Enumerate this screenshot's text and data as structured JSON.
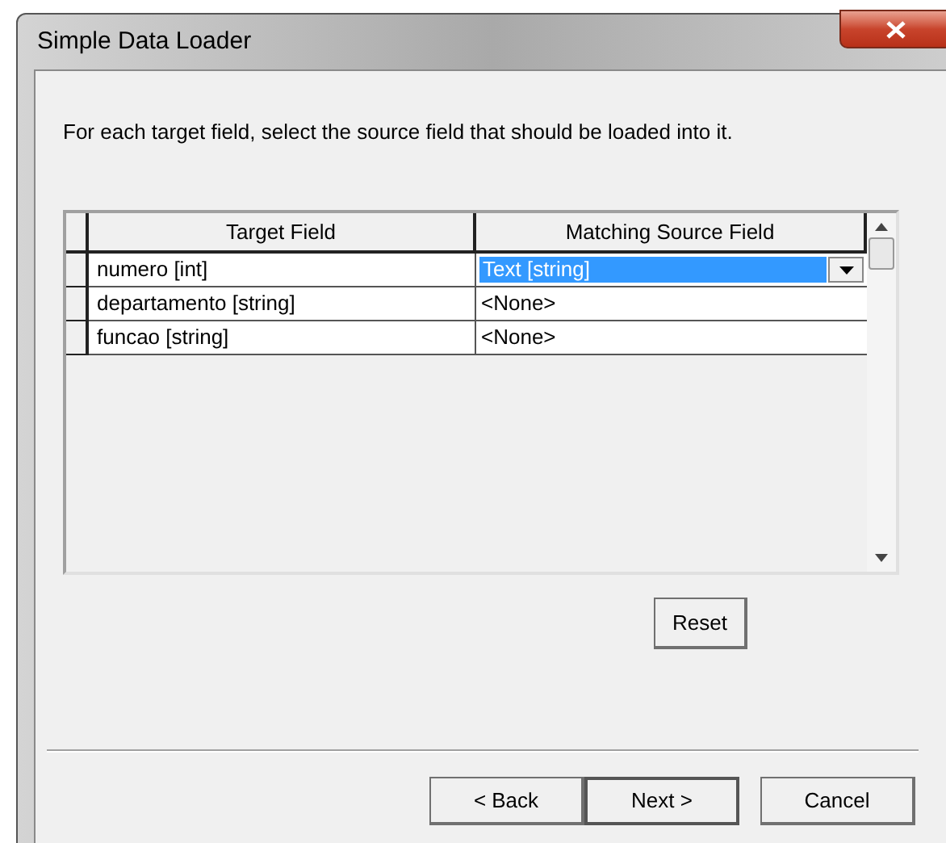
{
  "window": {
    "title": "Simple Data Loader"
  },
  "instruction": "For each target field, select the source field that should be loaded into it.",
  "table": {
    "columns": [
      "Target Field",
      "Matching Source Field"
    ],
    "rows": [
      {
        "target": "numero [int]",
        "source": "Text [string]",
        "selected": true
      },
      {
        "target": "departamento [string]",
        "source": "<None>",
        "selected": false
      },
      {
        "target": "funcao [string]",
        "source": "<None>",
        "selected": false
      }
    ]
  },
  "reset_button": "Reset",
  "buttons": [
    {
      "label": "< Back",
      "default": false
    },
    {
      "label": "Next >",
      "default": true
    },
    {
      "label": "Cancel",
      "default": false
    }
  ]
}
